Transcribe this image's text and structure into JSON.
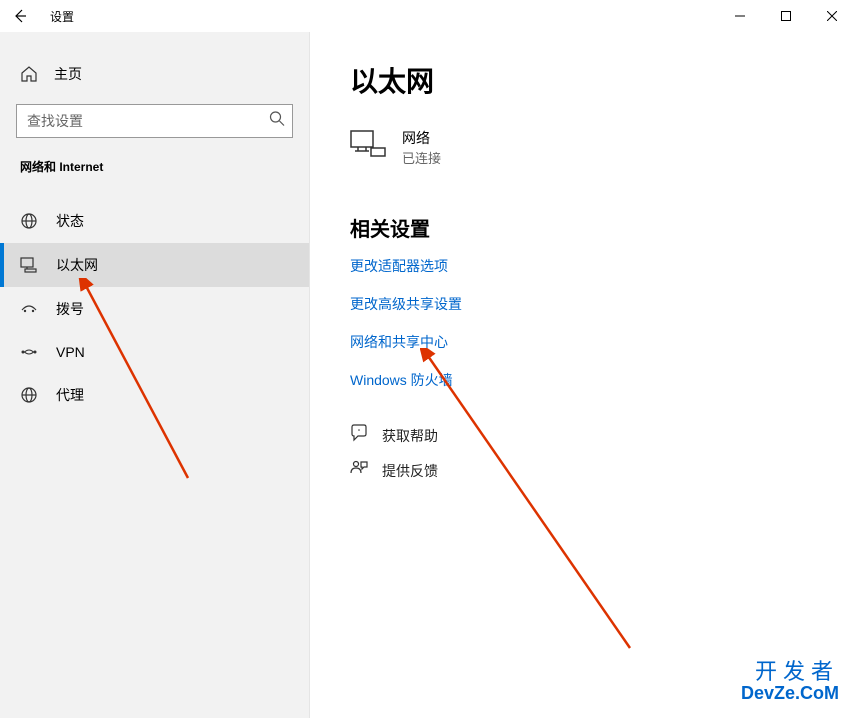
{
  "window": {
    "title": "设置"
  },
  "sidebar": {
    "home_label": "主页",
    "search_placeholder": "查找设置",
    "category_title": "网络和 Internet",
    "items": [
      {
        "label": "状态"
      },
      {
        "label": "以太网"
      },
      {
        "label": "拨号"
      },
      {
        "label": "VPN"
      },
      {
        "label": "代理"
      }
    ]
  },
  "main": {
    "page_title": "以太网",
    "network": {
      "name": "网络",
      "state": "已连接"
    },
    "related_title": "相关设置",
    "related_links": [
      "更改适配器选项",
      "更改高级共享设置",
      "网络和共享中心",
      "Windows 防火墙"
    ],
    "help": {
      "get_help": "获取帮助",
      "feedback": "提供反馈"
    }
  },
  "watermark": {
    "line1": "开发者",
    "line2": "DevZe.CoM"
  }
}
